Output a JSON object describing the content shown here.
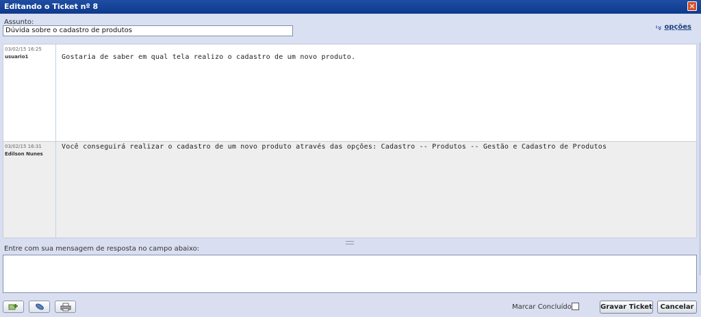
{
  "window": {
    "title": "Editando o Ticket nº 8",
    "close_glyph": "✕"
  },
  "subject": {
    "label": "Assunto:",
    "value": "Dúvida sobre o cadastro de produtos"
  },
  "options": {
    "label": "opções",
    "icon": "double-chevron-down-icon"
  },
  "messages": [
    {
      "date": "03/02/15 16:25",
      "author": "usuario1",
      "text": "Gostaria de saber em qual tela realizo o cadastro de um novo produto."
    },
    {
      "date": "03/02/15 16:31",
      "author": "Edilson Nunes",
      "text": "Você conseguirá realizar o cadastro de um novo produto através das opções: Cadastro -- Produtos -- Gestão e Cadastro de Produtos"
    }
  ],
  "reply": {
    "label": "Entre com sua mensagem de resposta no campo abaixo:",
    "value": ""
  },
  "footer": {
    "tools": [
      {
        "name": "add-attachment-icon"
      },
      {
        "name": "paperclip-icon"
      },
      {
        "name": "printer-icon"
      }
    ],
    "done_label": "Marcar Concluído:",
    "done_checked": false,
    "save_label": "Gravar Ticket",
    "cancel_label": "Cancelar"
  },
  "colors": {
    "titlebar": "#0d3a8c",
    "panel": "#d9e0f2",
    "close": "#d4502a"
  }
}
